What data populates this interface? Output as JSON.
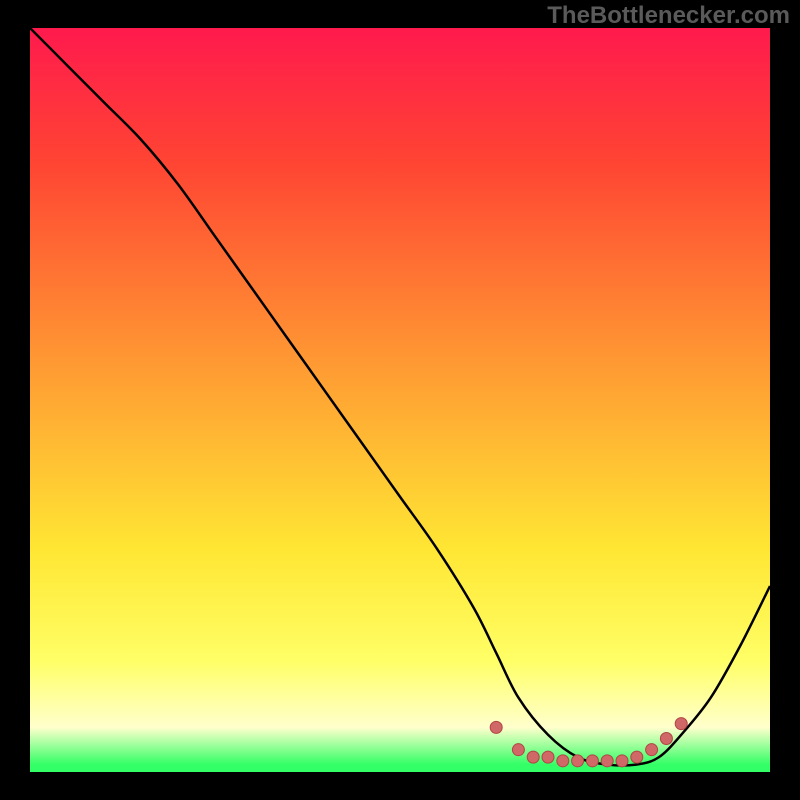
{
  "attribution": "TheBottlenecker.com",
  "chart_data": {
    "type": "line",
    "title": "",
    "xlabel": "",
    "ylabel": "",
    "xlim": [
      0,
      100
    ],
    "ylim": [
      0,
      100
    ],
    "series": [
      {
        "name": "bottleneck-curve",
        "x": [
          0,
          5,
          10,
          15,
          20,
          25,
          30,
          35,
          40,
          45,
          50,
          55,
          60,
          63,
          66,
          70,
          74,
          78,
          82,
          85,
          88,
          92,
          96,
          100
        ],
        "y": [
          100,
          95,
          90,
          85,
          79,
          72,
          65,
          58,
          51,
          44,
          37,
          30,
          22,
          16,
          10,
          5,
          2,
          1,
          1,
          2,
          5,
          10,
          17,
          25
        ]
      }
    ],
    "optimal_band": {
      "x_start": 63,
      "x_end": 88
    },
    "markers": [
      {
        "x": 63,
        "y": 6
      },
      {
        "x": 66,
        "y": 3
      },
      {
        "x": 68,
        "y": 2
      },
      {
        "x": 70,
        "y": 2
      },
      {
        "x": 72,
        "y": 1.5
      },
      {
        "x": 74,
        "y": 1.5
      },
      {
        "x": 76,
        "y": 1.5
      },
      {
        "x": 78,
        "y": 1.5
      },
      {
        "x": 80,
        "y": 1.5
      },
      {
        "x": 82,
        "y": 2
      },
      {
        "x": 84,
        "y": 3
      },
      {
        "x": 86,
        "y": 4.5
      },
      {
        "x": 88,
        "y": 6.5
      }
    ],
    "colors": {
      "gradient_top": "#ff1a4d",
      "gradient_upper": "#ff4433",
      "gradient_mid1": "#ff9933",
      "gradient_mid2": "#ffe633",
      "gradient_lower": "#ffff66",
      "gradient_lighter": "#ffffcc",
      "gradient_green": "#33ff66",
      "curve": "#000000",
      "marker_fill": "#d06868",
      "marker_stroke": "#b04545"
    }
  }
}
